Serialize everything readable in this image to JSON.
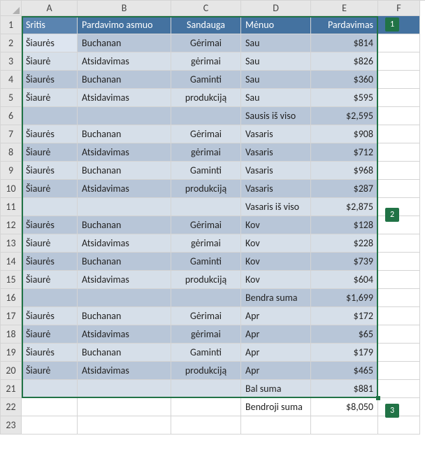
{
  "columns": [
    "A",
    "B",
    "C",
    "D",
    "E",
    "F"
  ],
  "row_count": 23,
  "badges": {
    "b1": "1",
    "b2": "2",
    "b3": "3"
  },
  "header": {
    "A": "Sritis",
    "B": "Pardavimo asmuo",
    "C": "Sandauga",
    "D": "Mėnuo",
    "E": "Pardavimas"
  },
  "rows": [
    {
      "n": 2,
      "band": "dark",
      "A": "Šiaurės",
      "B": "Buchanan",
      "C": "Gėrimai",
      "D": "Sau",
      "E": "$814"
    },
    {
      "n": 3,
      "band": "light",
      "A": "Šiaurė",
      "B": "Atsidavimas",
      "C": "gėrimai",
      "D": "Sau",
      "E": "$826"
    },
    {
      "n": 4,
      "band": "dark",
      "A": "Šiaurės",
      "B": "Buchanan",
      "C": "Gaminti",
      "D": "Sau",
      "E": "$360"
    },
    {
      "n": 5,
      "band": "light",
      "A": "Šiaurė",
      "B": "Atsidavimas",
      "C": "produkciją",
      "D": "Sau",
      "E": "$595"
    },
    {
      "n": 6,
      "band": "dark",
      "A": "",
      "B": "",
      "C": "",
      "D": "Sausis iš viso",
      "E": "$2,595"
    },
    {
      "n": 7,
      "band": "light",
      "A": "Šiaurės",
      "B": "Buchanan",
      "C": "Gėrimai",
      "D": "Vasaris",
      "E": "$908"
    },
    {
      "n": 8,
      "band": "dark",
      "A": "Šiaurė",
      "B": "Atsidavimas",
      "C": "gėrimai",
      "D": "Vasaris",
      "E": "$712"
    },
    {
      "n": 9,
      "band": "light",
      "A": "Šiaurės",
      "B": "Buchanan",
      "C": "Gaminti",
      "D": "Vasaris",
      "E": "$968"
    },
    {
      "n": 10,
      "band": "dark",
      "A": "Šiaurė",
      "B": "Atsidavimas",
      "C": "produkciją",
      "D": "Vasaris",
      "E": "$287"
    },
    {
      "n": 11,
      "band": "light",
      "A": "",
      "B": "",
      "C": "",
      "D": "Vasaris iš viso",
      "E": "$2,875"
    },
    {
      "n": 12,
      "band": "dark",
      "A": "Šiaurės",
      "B": "Buchanan",
      "C": "Gėrimai",
      "D": "Kov",
      "E": "$128"
    },
    {
      "n": 13,
      "band": "light",
      "A": "Šiaurė",
      "B": "Atsidavimas",
      "C": "gėrimai",
      "D": "Kov",
      "E": "$228"
    },
    {
      "n": 14,
      "band": "dark",
      "A": "Šiaurės",
      "B": "Buchanan",
      "C": "Gaminti",
      "D": "Kov",
      "E": "$739"
    },
    {
      "n": 15,
      "band": "light",
      "A": "Šiaurė",
      "B": "Atsidavimas",
      "C": "produkciją",
      "D": "Kov",
      "E": "$604"
    },
    {
      "n": 16,
      "band": "dark",
      "A": "",
      "B": "",
      "C": "",
      "D": "Bendra suma",
      "E": "$1,699"
    },
    {
      "n": 17,
      "band": "light",
      "A": "Šiaurės",
      "B": "Buchanan",
      "C": "Gėrimai",
      "D": "Apr",
      "E": "$172"
    },
    {
      "n": 18,
      "band": "dark",
      "A": "Šiaurė",
      "B": "Atsidavimas",
      "C": "gėrimai",
      "D": "Apr",
      "E": "$65"
    },
    {
      "n": 19,
      "band": "light",
      "A": "Šiaurės",
      "B": "Buchanan",
      "C": "Gaminti",
      "D": "Apr",
      "E": "$179"
    },
    {
      "n": 20,
      "band": "dark",
      "A": "Šiaurė",
      "B": "Atsidavimas",
      "C": "produkciją",
      "D": "Apr",
      "E": "$465"
    },
    {
      "n": 21,
      "band": "light",
      "A": "",
      "B": "",
      "C": "",
      "D": "Bal suma",
      "E": "$881"
    },
    {
      "n": 22,
      "band": "empty",
      "A": "",
      "B": "",
      "C": "",
      "D": "Bendroji suma",
      "E": "$8,050"
    },
    {
      "n": 23,
      "band": "empty",
      "A": "",
      "B": "",
      "C": "",
      "D": "",
      "E": ""
    }
  ]
}
